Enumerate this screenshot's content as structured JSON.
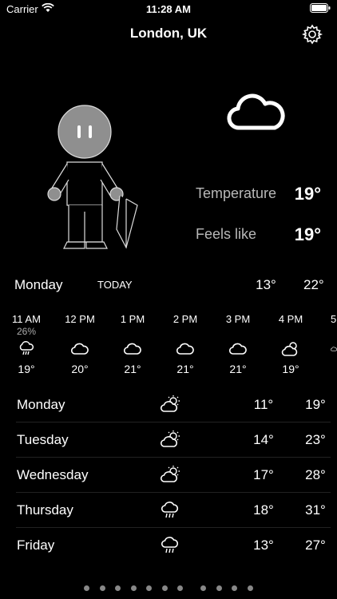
{
  "status": {
    "carrier": "Carrier",
    "time": "11:28 AM"
  },
  "header": {
    "city": "London, UK"
  },
  "current": {
    "temperature_label": "Temperature",
    "temperature_value": "19°",
    "feels_like_label": "Feels like",
    "feels_like_value": "19°"
  },
  "today": {
    "day": "Monday",
    "tag": "TODAY",
    "low": "13°",
    "high": "22°"
  },
  "hourly": [
    {
      "time": "11 AM",
      "pop": "26%",
      "icon": "rain-cloud-icon",
      "temp": "19°"
    },
    {
      "time": "12 PM",
      "pop": "",
      "icon": "cloud-icon",
      "temp": "20°"
    },
    {
      "time": "1 PM",
      "pop": "",
      "icon": "cloud-icon",
      "temp": "21°"
    },
    {
      "time": "2 PM",
      "pop": "",
      "icon": "cloud-icon",
      "temp": "21°"
    },
    {
      "time": "3 PM",
      "pop": "",
      "icon": "cloud-icon",
      "temp": "21°"
    },
    {
      "time": "4 PM",
      "pop": "",
      "icon": "partly-cloudy-icon",
      "temp": "19°"
    },
    {
      "time": "5",
      "pop": "",
      "icon": "cloud-icon",
      "temp": ""
    }
  ],
  "daily": [
    {
      "day": "Monday",
      "icon": "partly-sunny-icon",
      "low": "11°",
      "high": "19°"
    },
    {
      "day": "Tuesday",
      "icon": "partly-sunny-icon",
      "low": "14°",
      "high": "23°"
    },
    {
      "day": "Wednesday",
      "icon": "partly-sunny-icon",
      "low": "17°",
      "high": "28°"
    },
    {
      "day": "Thursday",
      "icon": "rain-cloud-icon",
      "low": "18°",
      "high": "31°"
    },
    {
      "day": "Friday",
      "icon": "rain-cloud-icon",
      "low": "13°",
      "high": "27°"
    }
  ],
  "pager": {
    "current_page": 1,
    "total_pages": 11
  },
  "colors": {
    "background": "#000000",
    "text": "#ffffff",
    "muted": "#b8b8b8"
  }
}
